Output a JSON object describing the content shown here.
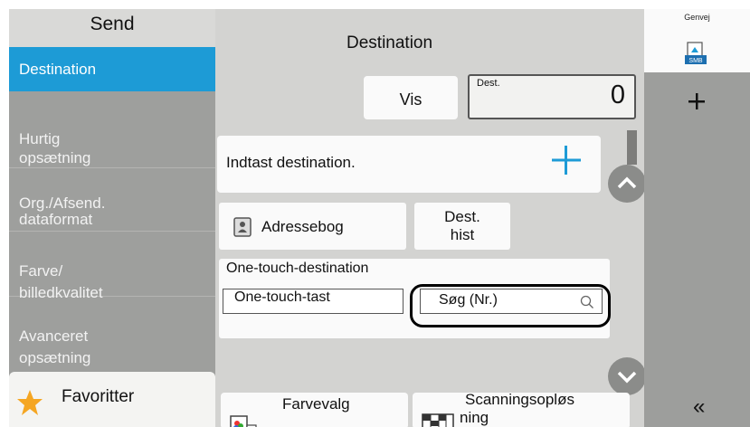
{
  "sidebar": {
    "title": "Send",
    "items": [
      {
        "label": "Destination",
        "active": true
      },
      {
        "label": "Hurtig\nopsætning",
        "active": false
      },
      {
        "label": "Org./Afsend.\ndataformat",
        "active": false
      },
      {
        "label": "Farve/\nbilledkvalitet",
        "active": false
      },
      {
        "label": "Avanceret\nopsætning",
        "active": false
      }
    ],
    "favorites_label": "Favoritter"
  },
  "main": {
    "title": "Destination",
    "view_button": "Vis",
    "dest_label": "Dest.",
    "dest_count": "0",
    "enter_destination": "Indtast destination.",
    "address_book": "Adressebog",
    "dest_history_line1": "Dest.",
    "dest_history_line2": "hist",
    "one_touch_heading": "One-touch-destination",
    "one_touch_key": "One-touch-tast",
    "search_number": "Søg (Nr.)",
    "color_selection": "Farvevalg",
    "scan_resolution_line1": "Scanningsopløs",
    "scan_resolution_line2": "ning"
  },
  "shortcut_bar": {
    "tab_label": "Genvej",
    "icon_text": "SMB",
    "collapse_glyph": "«"
  },
  "colors": {
    "active_blue": "#1d9bd6",
    "plus_blue": "#1d9bd6",
    "star_orange": "#f5a623"
  }
}
